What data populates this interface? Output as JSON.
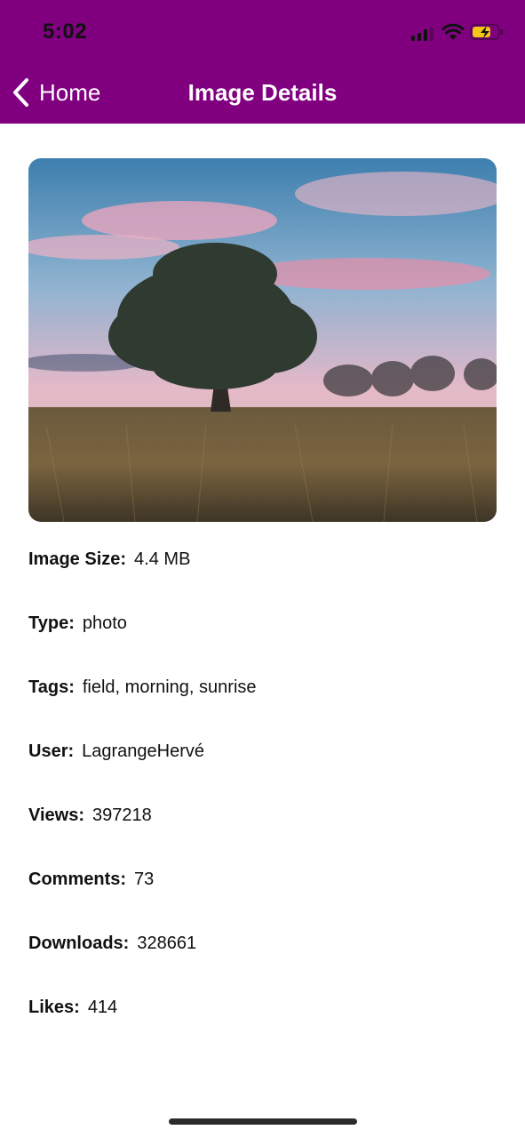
{
  "status_bar": {
    "time": "5:02"
  },
  "nav": {
    "back_label": "Home",
    "title": "Image Details"
  },
  "details": [
    {
      "label": "Image Size:",
      "value": "4.4 MB"
    },
    {
      "label": "Type:",
      "value": "photo"
    },
    {
      "label": "Tags:",
      "value": "field, morning, sunrise"
    },
    {
      "label": "User:",
      "value": "LagrangeHervé"
    },
    {
      "label": "Views:",
      "value": "397218"
    },
    {
      "label": "Comments:",
      "value": "73"
    },
    {
      "label": "Downloads:",
      "value": "328661"
    },
    {
      "label": "Likes:",
      "value": "414"
    }
  ],
  "colors": {
    "header": "#800080",
    "header_text": "#ffffff",
    "text": "#111111",
    "battery": "#f5c518"
  }
}
